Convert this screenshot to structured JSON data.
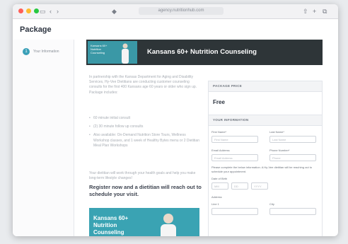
{
  "browser": {
    "url": "agency.nutritionhub.com",
    "colors": {
      "close": "#ff5f57",
      "minimize": "#febc2e",
      "maximize": "#28c840"
    },
    "icons": [
      "sidebar-icon",
      "back-icon",
      "forward-icon",
      "shield-icon",
      "share-icon",
      "new-tab-icon",
      "tabs-icon"
    ]
  },
  "page": {
    "title": "Package"
  },
  "sidebar": {
    "steps": [
      {
        "number": "1",
        "label": "Your Information"
      }
    ]
  },
  "banner": {
    "thumb_text": "Kansans 60+ Nutrition Counseling",
    "title": "Kansans 60+ Nutrition Counseling"
  },
  "description": {
    "intro": "In partnership with the Kansas Department for Aging and Disability Services, Hy-Vee Dietitians are conducting customer counseling consults for the first 400 Kansans age 60 years or older who sign up. Package includes:",
    "bullets": [
      "60 minute initial consult",
      "(2) 30 minute follow up consults",
      "Also available: On-Demand Nutrition Store Tours, Wellness Workshop classes, and 1 week of Healthy Bytes menu or 2 Dietitian Meal Plan Workshops"
    ],
    "p2": "Your dietitian will work through your health goals and help you make long-term lifestyle changes!",
    "cta": "Register now and a dietitian will reach out to schedule your visit."
  },
  "promo": {
    "title": "Kansans 60+ Nutrition Counseling"
  },
  "side_panel": {
    "price_header": "PACKAGE PRICE",
    "price": "Free",
    "info_header": "YOUR INFORMATION",
    "fields": {
      "first_name_label": "First Name*",
      "first_name_placeholder": "First Name",
      "last_name_label": "Last Name*",
      "last_name_placeholder": "Last Name",
      "email_label": "Email Address",
      "email_placeholder": "Email Address",
      "phone_label": "Phone Number*",
      "phone_placeholder": "Phone",
      "note": "Please complete the below information. A Hy-Vee dietitian will be reaching out to schedule your appointment.",
      "dob_label": "Date of Birth",
      "month_placeholder": "MM",
      "day_placeholder": "DD",
      "year_placeholder": "YYYY",
      "address_label": "Address",
      "line1_label": "Line 1",
      "city_label": "City"
    }
  }
}
